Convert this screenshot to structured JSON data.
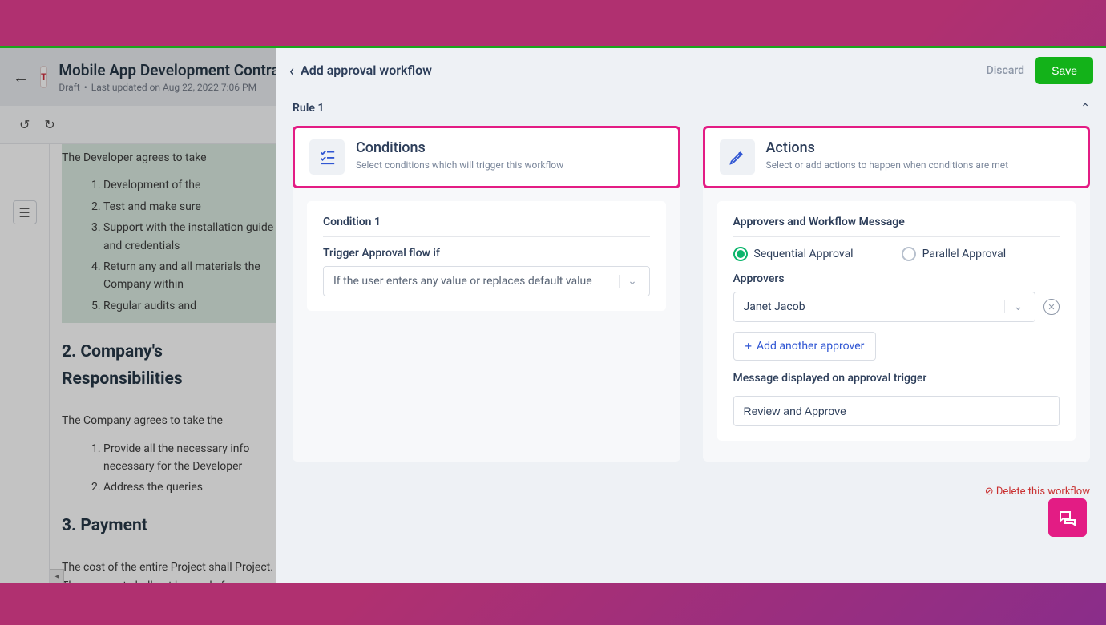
{
  "doc": {
    "badge": "T",
    "title": "Mobile App Development Contract",
    "status": "Draft",
    "updated": "Last updated on Aug 22, 2022 7:06 PM",
    "intro": "The Developer agrees to take",
    "list1": [
      "Development of the",
      "Test and make sure",
      "Support with the installation guide and credentials",
      "Return any and all materials the Company within",
      "Regular audits and"
    ],
    "h2a": "2. Company's Responsibilities",
    "p2": "The Company agrees to take the",
    "list2": [
      "Provide all the necessary info necessary for the Developer",
      "Address the queries"
    ],
    "h2b": "3. Payment",
    "p3": "The cost of the entire Project shall Project. The payment shall not be made for essential resources"
  },
  "drawer": {
    "title": "Add approval workflow",
    "discard": "Discard",
    "save": "Save",
    "rule": "Rule 1",
    "conditions": {
      "title": "Conditions",
      "sub": "Select conditions which will trigger this workflow",
      "card_title": "Condition 1",
      "trigger_label": "Trigger Approval flow if",
      "trigger_value": "If the user enters any value or replaces default value"
    },
    "actions": {
      "title": "Actions",
      "sub": "Select or add actions to happen when conditions are met",
      "card_title": "Approvers and Workflow Message",
      "seq": "Sequential Approval",
      "par": "Parallel Approval",
      "approvers_label": "Approvers",
      "approver_value": "Janet Jacob",
      "add_another": "Add another approver",
      "msg_label": "Message displayed on approval trigger",
      "msg_value": "Review and Approve"
    },
    "delete": "Delete this workflow"
  }
}
